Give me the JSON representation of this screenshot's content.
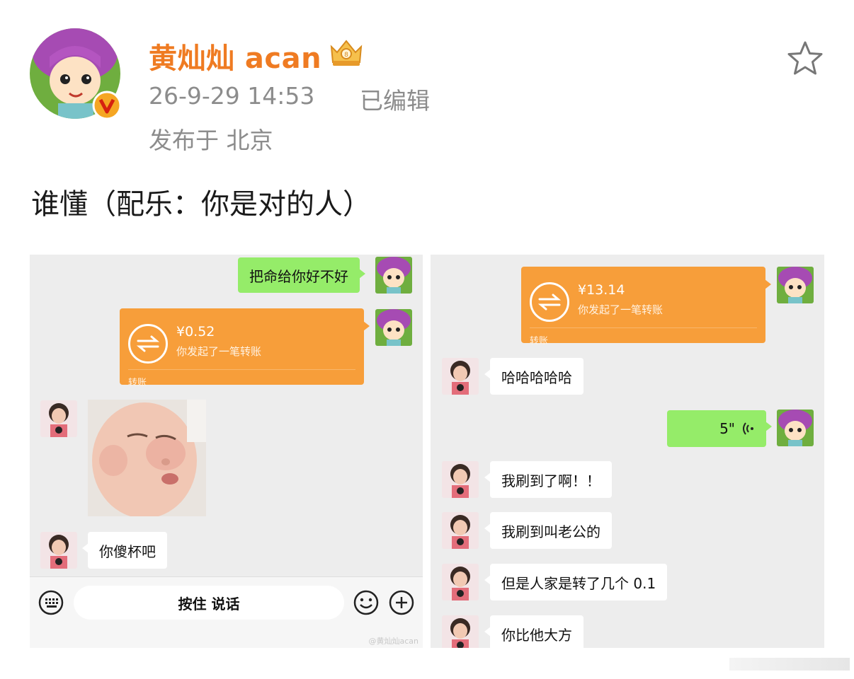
{
  "post": {
    "author": "黄灿灿 acan",
    "time": "26-9-29 14:53",
    "edited": "已编辑",
    "location": "发布于 北京",
    "text": "谁懂（配乐：你是对的人）"
  },
  "left_chat": {
    "msg1": "把命给你好不好",
    "transfer": {
      "amount": "¥0.52",
      "desc": "你发起了一笔转账",
      "label": "转账"
    },
    "msg2": "你傻杯吧",
    "input": {
      "hold_to_talk": "按住 说话"
    },
    "watermark": "@黄灿灿acan"
  },
  "right_chat": {
    "transfer": {
      "amount": "¥13.14",
      "desc": "你发起了一笔转账",
      "label": "转账"
    },
    "msg1": "哈哈哈哈哈",
    "voice": "5\"",
    "msg2": "我刷到了啊！！",
    "msg3": "我刷到叫老公的",
    "msg4": "但是人家是转了几个 0.1",
    "msg5": "你比他大方"
  },
  "colors": {
    "author": "#ef7b22",
    "meta": "#8c8c8c",
    "bubble_green": "#95ec69",
    "transfer_orange": "#f79e3a",
    "chat_bg": "#ededed"
  }
}
